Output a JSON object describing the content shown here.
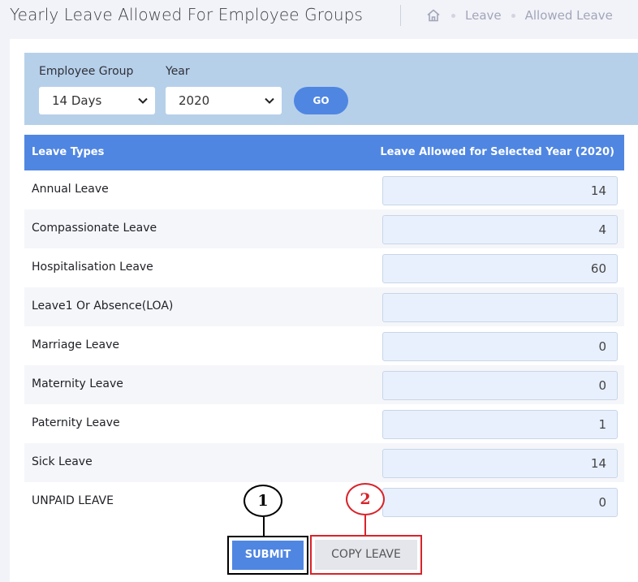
{
  "header": {
    "title": "Yearly Leave Allowed For Employee Groups",
    "breadcrumb": [
      "Leave",
      "Allowed Leave"
    ]
  },
  "filters": {
    "employee_group_label": "Employee Group",
    "employee_group_value": "14 Days",
    "year_label": "Year",
    "year_value": "2020",
    "go_label": "GO"
  },
  "table": {
    "col_type": "Leave Types",
    "col_allowed": "Leave Allowed for Selected Year (2020)",
    "rows": [
      {
        "type": "Annual Leave",
        "value": "14"
      },
      {
        "type": "Compassionate Leave",
        "value": "4"
      },
      {
        "type": "Hospitalisation Leave",
        "value": "60"
      },
      {
        "type": "Leave1 Or Absence(LOA)",
        "value": ""
      },
      {
        "type": "Marriage Leave",
        "value": "0"
      },
      {
        "type": "Maternity Leave",
        "value": "0"
      },
      {
        "type": "Paternity Leave",
        "value": "1"
      },
      {
        "type": "Sick Leave",
        "value": "14"
      },
      {
        "type": "UNPAID LEAVE",
        "value": "0"
      }
    ]
  },
  "actions": {
    "submit_label": "SUBMIT",
    "copy_label": "COPY LEAVE"
  },
  "callouts": [
    "1",
    "2"
  ],
  "colors": {
    "accent": "#4f86e2",
    "filter_bg": "#b7d0ea",
    "input_bg": "#e8f0fe",
    "callout_red": "#d8232a"
  }
}
